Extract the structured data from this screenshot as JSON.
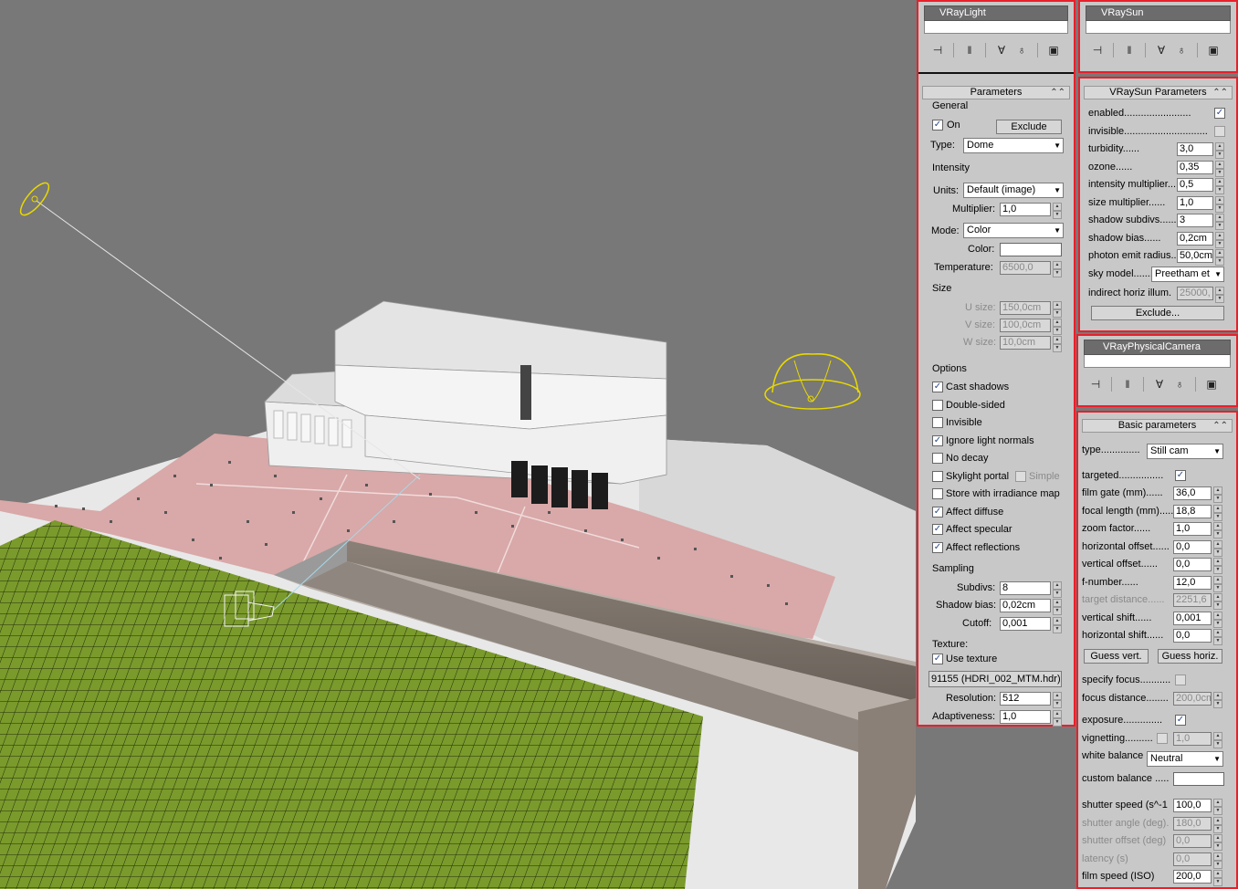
{
  "viewport": {
    "label": "3d-scene-viewport"
  },
  "vraylight": {
    "object_name": "VRayLight",
    "rollout_title": "Parameters",
    "general_label": "General",
    "on_label": "On",
    "on_checked": true,
    "exclude_label": "Exclude",
    "type_label": "Type:",
    "type_value": "Dome",
    "intensity_label": "Intensity",
    "units_label": "Units:",
    "units_value": "Default (image)",
    "multiplier_label": "Multiplier:",
    "multiplier_value": "1,0",
    "mode_label": "Mode:",
    "mode_value": "Color",
    "color_label": "Color:",
    "temperature_label": "Temperature:",
    "temperature_value": "6500,0",
    "size_label": "Size",
    "usize_label": "U size:",
    "usize_value": "150,0cm",
    "vsize_label": "V size:",
    "vsize_value": "100,0cm",
    "wsize_label": "W size:",
    "wsize_value": "10,0cm",
    "options_label": "Options",
    "options": [
      {
        "label": "Cast shadows",
        "checked": true
      },
      {
        "label": "Double-sided",
        "checked": false
      },
      {
        "label": "Invisible",
        "checked": false
      },
      {
        "label": "Ignore light normals",
        "checked": true
      },
      {
        "label": "No decay",
        "checked": false
      },
      {
        "label": "Skylight portal",
        "checked": false
      },
      {
        "label": "Store with irradiance map",
        "checked": false
      },
      {
        "label": "Affect diffuse",
        "checked": true
      },
      {
        "label": "Affect specular",
        "checked": true
      },
      {
        "label": "Affect reflections",
        "checked": true
      }
    ],
    "simple_label": "Simple",
    "sampling_label": "Sampling",
    "subdivs_label": "Subdivs:",
    "subdivs_value": "8",
    "shadowbias_label": "Shadow bias:",
    "shadowbias_value": "0,02cm",
    "cutoff_label": "Cutoff:",
    "cutoff_value": "0,001",
    "texture_label": "Texture:",
    "use_texture_label": "Use texture",
    "texture_map": "91155 (HDRI_002_MTM.hdr)",
    "resolution_label": "Resolution:",
    "resolution_value": "512",
    "adaptiveness_label": "Adaptiveness:",
    "adaptiveness_value": "1,0"
  },
  "vraysun": {
    "object_name": "VRaySun",
    "rollout_title": "VRaySun Parameters",
    "enabled_label": "enabled",
    "invisible_label": "invisible",
    "rows": [
      {
        "label": "turbidity",
        "value": "3,0"
      },
      {
        "label": "ozone",
        "value": "0,35"
      },
      {
        "label": "intensity multiplier",
        "value": "0,5"
      },
      {
        "label": "size multiplier",
        "value": "1,0"
      },
      {
        "label": "shadow subdivs",
        "value": "3"
      },
      {
        "label": "shadow bias",
        "value": "0,2cm"
      },
      {
        "label": "photon emit radius",
        "value": "50,0cm"
      }
    ],
    "sky_model_label": "sky model",
    "sky_model_value": "Preetham et",
    "indirect_label": "indirect horiz illum.",
    "indirect_value": "25000,",
    "exclude_label": "Exclude..."
  },
  "vraycam": {
    "object_name": "VRayPhysicalCamera",
    "rollout_title": "Basic parameters",
    "type_label": "type",
    "type_value": "Still cam",
    "targeted_label": "targeted",
    "rows1": [
      {
        "label": "film gate (mm)",
        "value": "36,0",
        "dis": false
      },
      {
        "label": "focal length (mm)",
        "value": "18,8",
        "dis": false
      },
      {
        "label": "zoom factor",
        "value": "1,0",
        "dis": false
      },
      {
        "label": "horizontal offset",
        "value": "0,0",
        "dis": false
      },
      {
        "label": "vertical offset",
        "value": "0,0",
        "dis": false
      },
      {
        "label": "f-number",
        "value": "12,0",
        "dis": false
      },
      {
        "label": "target distance",
        "value": "2251,6",
        "dis": true
      },
      {
        "label": "vertical shift",
        "value": "0,001",
        "dis": false
      },
      {
        "label": "horizontal shift",
        "value": "0,0",
        "dis": false
      }
    ],
    "guess_vert_label": "Guess vert.",
    "guess_horiz_label": "Guess horiz.",
    "specify_focus_label": "specify focus",
    "focus_distance_label": "focus distance",
    "focus_distance_value": "200,0cm",
    "exposure_label": "exposure",
    "vignetting_label": "vignetting",
    "vignetting_value": "1,0",
    "white_balance_label": "white balance",
    "white_balance_value": "Neutral",
    "custom_balance_label": "custom balance .....",
    "rows2": [
      {
        "label": "shutter speed (s^-1",
        "value": "100,0",
        "dis": false
      },
      {
        "label": "shutter angle (deg).",
        "value": "180,0",
        "dis": true
      },
      {
        "label": "shutter offset (deg)",
        "value": "0,0",
        "dis": true
      },
      {
        "label": "latency (s)",
        "value": "0,0",
        "dis": true
      },
      {
        "label": "film speed (ISO)",
        "value": "200,0",
        "dis": false
      }
    ]
  },
  "colors": {
    "highlight_border": "#e8202a",
    "panel_bg": "#c8c8c8",
    "viewport_bg": "#787878",
    "grass": "#7a9a2c",
    "terrain_pink": "#d9a8a8"
  }
}
